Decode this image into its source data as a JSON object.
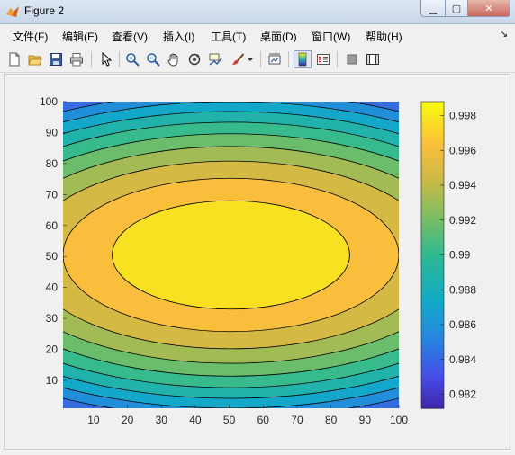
{
  "window": {
    "title": "Figure 2"
  },
  "menu": [
    "文件(F)",
    "编辑(E)",
    "查看(V)",
    "插入(I)",
    "工具(T)",
    "桌面(D)",
    "窗口(W)",
    "帮助(H)"
  ],
  "toolbar_icons": [
    "new-figure-icon",
    "open-file-icon",
    "save-icon",
    "print-icon",
    "pointer-icon",
    "zoom-in-icon",
    "zoom-out-icon",
    "pan-hand-icon",
    "rotate-3d-icon",
    "data-cursor-icon",
    "brush-icon",
    "brush-dropdown-icon",
    "link-plot-icon",
    "colorbar-icon",
    "legend-icon",
    "hide-plot-tools-icon",
    "show-plot-tools-icon"
  ],
  "chart_data": {
    "type": "contourf",
    "title": "",
    "xlabel": "",
    "ylabel": "",
    "xlim": [
      1,
      100
    ],
    "ylim": [
      1,
      100
    ],
    "x_ticks": [
      10,
      20,
      30,
      40,
      50,
      60,
      70,
      80,
      90,
      100
    ],
    "y_ticks": [
      10,
      20,
      30,
      40,
      50,
      60,
      70,
      80,
      90,
      100
    ],
    "center": [
      50.5,
      50.5
    ],
    "z_range": [
      0.9805,
      0.9985
    ],
    "contour_levels": [
      0.9805,
      0.982,
      0.9835,
      0.985,
      0.9865,
      0.988,
      0.9895,
      0.991,
      0.9925,
      0.994,
      0.9955,
      0.997,
      0.9985
    ],
    "colormap": "parula",
    "colorbar": {
      "location": "right",
      "range": [
        0.9812,
        0.9988
      ],
      "ticks": [
        0.982,
        0.984,
        0.986,
        0.988,
        0.99,
        0.992,
        0.994,
        0.996,
        0.998
      ],
      "tick_labels": [
        "0.982",
        "0.984",
        "0.986",
        "0.988",
        "0.99",
        "0.992",
        "0.994",
        "0.996",
        "0.998"
      ]
    },
    "line_color": "#000000",
    "grid": false
  }
}
